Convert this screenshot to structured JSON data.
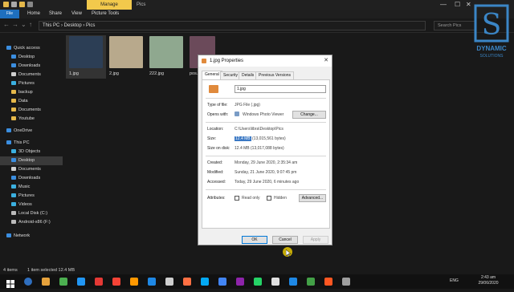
{
  "window": {
    "manage_tab": "Manage",
    "title": "Pics",
    "minimize": "—",
    "maximize": "☐",
    "close": "✕"
  },
  "ribbon": {
    "file": "File",
    "tabs": [
      "Home",
      "Share",
      "View",
      "Picture Tools"
    ]
  },
  "address": {
    "path": "This PC  ›  Desktop  ›  Pics",
    "search_placeholder": "Search Pics"
  },
  "sidebar": {
    "items": [
      {
        "label": "Quick access",
        "color": "#3b8ee0"
      },
      {
        "label": "Desktop",
        "color": "#3b8ee0"
      },
      {
        "label": "Downloads",
        "color": "#3b8ee0"
      },
      {
        "label": "Documents",
        "color": "#cfcfcf"
      },
      {
        "label": "Pictures",
        "color": "#3bb0e0"
      },
      {
        "label": "backup",
        "color": "#e5b84a"
      },
      {
        "label": "Data",
        "color": "#e5b84a"
      },
      {
        "label": "Documents",
        "color": "#e5b84a"
      },
      {
        "label": "Youtube",
        "color": "#e5b84a"
      },
      {
        "label": "OneDrive",
        "color": "#3b8ee0"
      },
      {
        "label": "This PC",
        "color": "#3b8ee0"
      },
      {
        "label": "3D Objects",
        "color": "#3bb0e0"
      },
      {
        "label": "Desktop",
        "color": "#3b8ee0"
      },
      {
        "label": "Documents",
        "color": "#cfcfcf"
      },
      {
        "label": "Downloads",
        "color": "#3b8ee0"
      },
      {
        "label": "Music",
        "color": "#3bb0e0"
      },
      {
        "label": "Pictures",
        "color": "#3bb0e0"
      },
      {
        "label": "Videos",
        "color": "#3bb0e0"
      },
      {
        "label": "Local Disk (C:)",
        "color": "#bbbbbb"
      },
      {
        "label": "Android-x86 (F:)",
        "color": "#bbbbbb"
      },
      {
        "label": "Network",
        "color": "#3b8ee0"
      }
    ]
  },
  "files": [
    {
      "name": "1.jpg",
      "color": "#2c3e55"
    },
    {
      "name": "2.jpg",
      "color": "#b8a98c"
    },
    {
      "name": "222.jpg",
      "color": "#8fa88f"
    },
    {
      "name": "pos...",
      "color": "#6b4a5a"
    }
  ],
  "logo": {
    "line1": "DYNAMIC",
    "line2": "SOLUTIONS"
  },
  "dialog": {
    "title": "1.jpg Properties",
    "tabs": [
      "General",
      "Security",
      "Details",
      "Previous Versions"
    ],
    "filename": "1.jpg",
    "type_label": "Type of file:",
    "type_value": "JPG File (.jpg)",
    "opens_label": "Opens with:",
    "opens_value": "Windows Photo Viewer",
    "change_btn": "Change...",
    "location_label": "Location:",
    "location_value": "C:\\Users\\libra\\Desktop\\Pics",
    "size_label": "Size:",
    "size_value_hl": "12.4 MB",
    "size_value_rest": "(13,015,561 bytes)",
    "disk_label": "Size on disk:",
    "disk_value": "12.4 MB (13,017,088 bytes)",
    "created_label": "Created:",
    "created_value": "Monday, 29 June 2020, 2:35:34 am",
    "modified_label": "Modified:",
    "modified_value": "Sunday, 21 June 2020, 9:07:45 pm",
    "accessed_label": "Accessed:",
    "accessed_value": "Today, 29 June 2020, 6 minutes ago",
    "attr_label": "Attributes:",
    "readonly_label": "Read only",
    "hidden_label": "Hidden",
    "advanced_btn": "Advanced...",
    "ok": "OK",
    "cancel": "Cancel",
    "apply": "Apply"
  },
  "status": {
    "count": "4 items",
    "selected": "1 item selected  12.4 MB"
  },
  "taskbar": {
    "time": "2:43 am",
    "date": "29/06/2020",
    "lang": "ENG",
    "icons": [
      "#2f6fbf",
      "#e6a23c",
      "#4caf50",
      "#2196f3",
      "#e53935",
      "#f44336",
      "#ff9800",
      "#1e88e5",
      "#cfcfcf",
      "#ff7043",
      "#03a9f4",
      "#4285f4",
      "#8e24aa",
      "#25d366",
      "#e0e0e0",
      "#1e88e5",
      "#43a047",
      "#ff5722",
      "#9e9e9e"
    ]
  }
}
